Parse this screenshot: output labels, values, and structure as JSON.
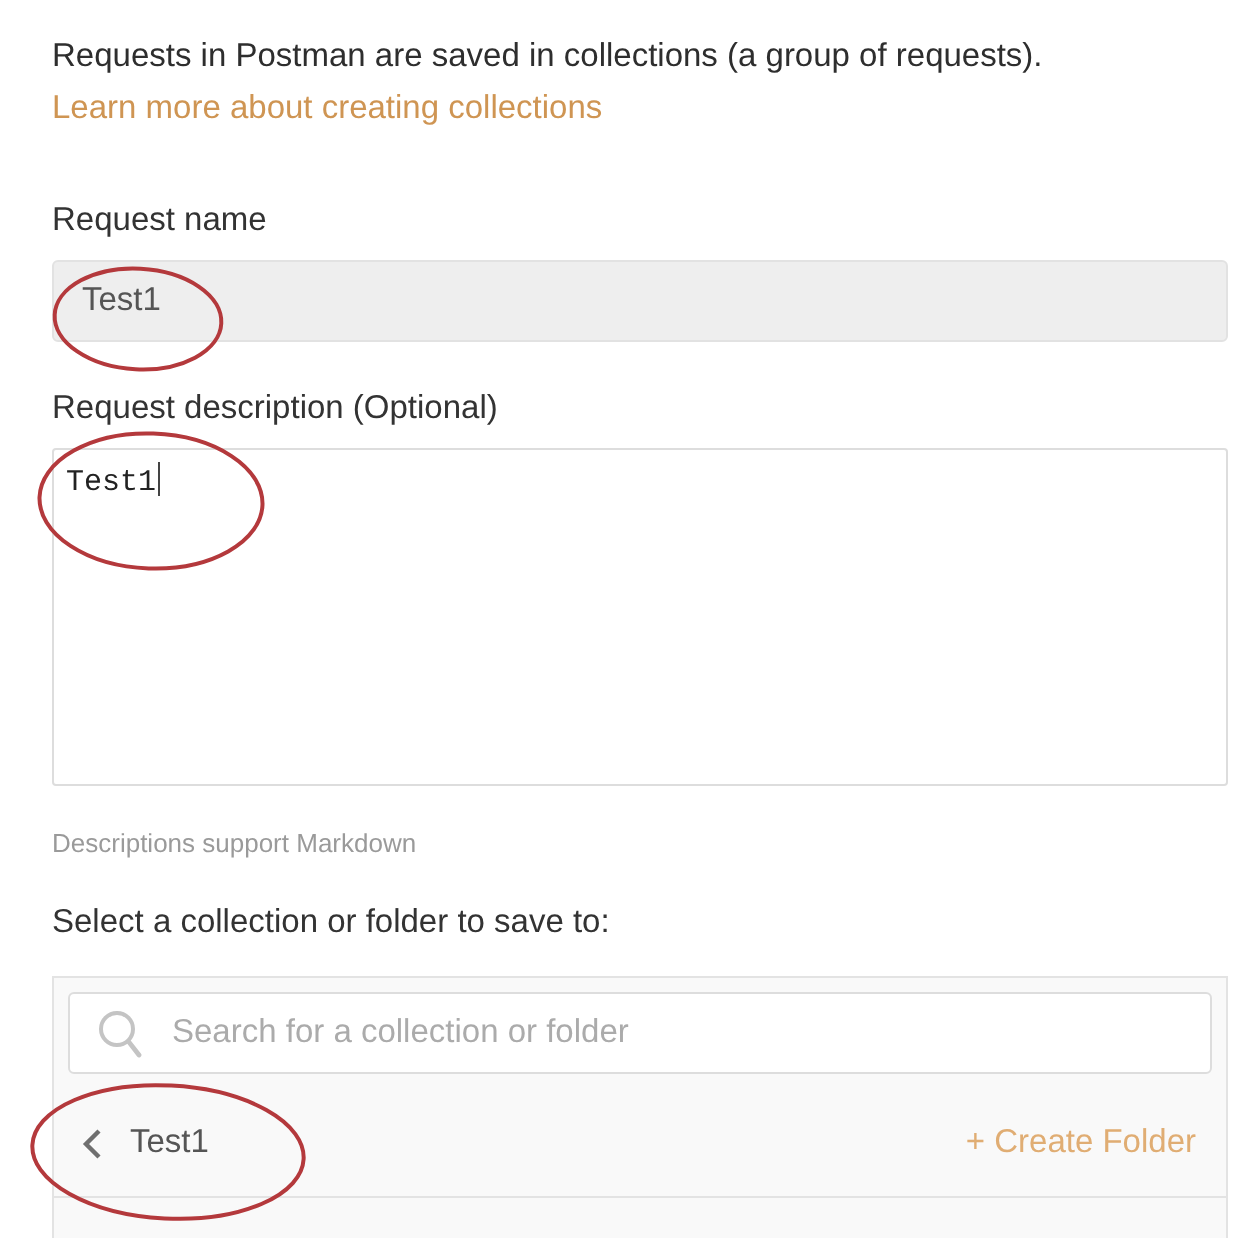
{
  "intro": {
    "text": "Requests in Postman are saved in collections (a group of requests).",
    "link": "Learn more about creating collections"
  },
  "request_name": {
    "label": "Request name",
    "value": "Test1",
    "circled": true
  },
  "request_description": {
    "label": "Request description (Optional)",
    "value": "Test1",
    "focused": true,
    "circled": true,
    "hint": "Descriptions support Markdown"
  },
  "collection_picker": {
    "label": "Select a collection or folder to save to:",
    "search": {
      "placeholder": "Search for a collection or folder"
    },
    "current": {
      "name": "Test1",
      "circled": true
    },
    "create_folder": "+ Create Folder"
  }
}
